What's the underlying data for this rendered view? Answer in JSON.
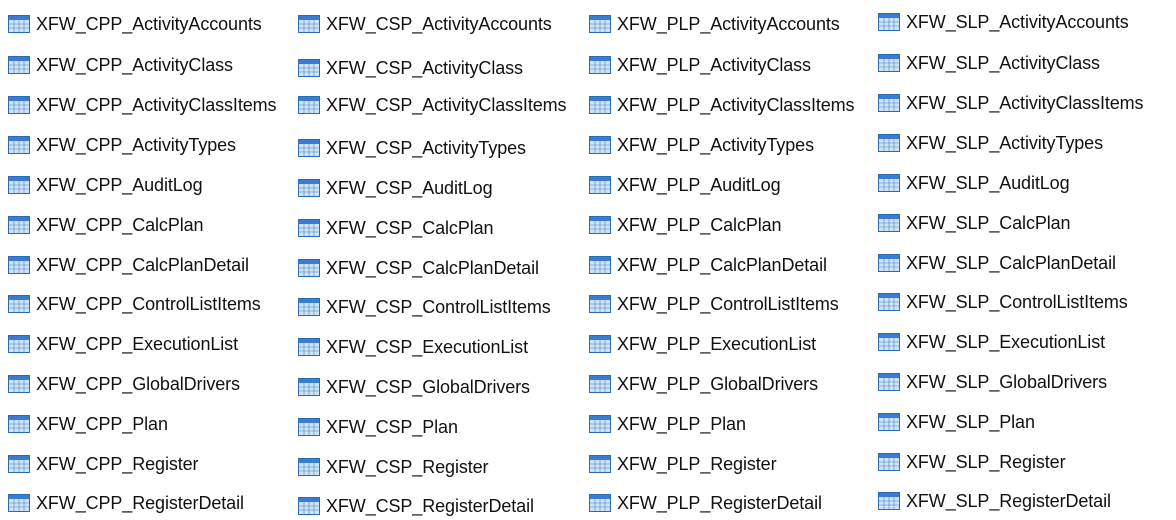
{
  "icon": "table-icon",
  "colors": {
    "icon_border": "#2b6cb0",
    "icon_header": "#3a7bd5",
    "icon_cell": "#cfe3f7",
    "text": "#111111"
  },
  "columns": [
    {
      "items": [
        "XFW_CPP_ActivityAccounts",
        "XFW_CPP_ActivityClass",
        "XFW_CPP_ActivityClassItems",
        "XFW_CPP_ActivityTypes",
        "XFW_CPP_AuditLog",
        "XFW_CPP_CalcPlan",
        "XFW_CPP_CalcPlanDetail",
        "XFW_CPP_ControlListItems",
        "XFW_CPP_ExecutionList",
        "XFW_CPP_GlobalDrivers",
        "XFW_CPP_Plan",
        "XFW_CPP_Register",
        "XFW_CPP_RegisterDetail"
      ]
    },
    {
      "items": [
        "XFW_CSP_ActivityAccounts",
        "XFW_CSP_ActivityClass",
        "XFW_CSP_ActivityClassItems",
        "XFW_CSP_ActivityTypes",
        "XFW_CSP_AuditLog",
        "XFW_CSP_CalcPlan",
        "XFW_CSP_CalcPlanDetail",
        "XFW_CSP_ControlListItems",
        "XFW_CSP_ExecutionList",
        "XFW_CSP_GlobalDrivers",
        "XFW_CSP_Plan",
        "XFW_CSP_Register",
        "XFW_CSP_RegisterDetail"
      ]
    },
    {
      "items": [
        "XFW_PLP_ActivityAccounts",
        "XFW_PLP_ActivityClass",
        "XFW_PLP_ActivityClassItems",
        "XFW_PLP_ActivityTypes",
        "XFW_PLP_AuditLog",
        "XFW_PLP_CalcPlan",
        "XFW_PLP_CalcPlanDetail",
        "XFW_PLP_ControlListItems",
        "XFW_PLP_ExecutionList",
        "XFW_PLP_GlobalDrivers",
        "XFW_PLP_Plan",
        "XFW_PLP_Register",
        "XFW_PLP_RegisterDetail"
      ]
    },
    {
      "items": [
        "XFW_SLP_ActivityAccounts",
        "XFW_SLP_ActivityClass",
        "XFW_SLP_ActivityClassItems",
        "XFW_SLP_ActivityTypes",
        "XFW_SLP_AuditLog",
        "XFW_SLP_CalcPlan",
        "XFW_SLP_CalcPlanDetail",
        "XFW_SLP_ControlListItems",
        "XFW_SLP_ExecutionList",
        "XFW_SLP_GlobalDrivers",
        "XFW_SLP_Plan",
        "XFW_SLP_Register",
        "XFW_SLP_RegisterDetail"
      ]
    }
  ]
}
